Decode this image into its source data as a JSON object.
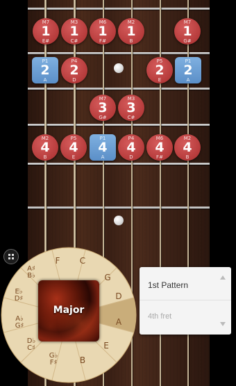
{
  "fretboard": {
    "notes": [
      {
        "interval": "M7",
        "finger": "1",
        "name": "E#",
        "shape": "red"
      },
      {
        "interval": "M3",
        "finger": "1",
        "name": "C#",
        "shape": "red"
      },
      {
        "interval": "M6",
        "finger": "1",
        "name": "F#",
        "shape": "red"
      },
      {
        "interval": "M2",
        "finger": "1",
        "name": "B",
        "shape": "red"
      },
      {
        "interval": "M7",
        "finger": "1",
        "name": "G#",
        "shape": "red"
      },
      {
        "interval": "P1",
        "finger": "2",
        "name": "A",
        "shape": "blue"
      },
      {
        "interval": "P4",
        "finger": "2",
        "name": "D",
        "shape": "red"
      },
      {
        "interval": "P5",
        "finger": "2",
        "name": "E",
        "shape": "red"
      },
      {
        "interval": "P1",
        "finger": "2",
        "name": "A",
        "shape": "blue"
      },
      {
        "interval": "M7",
        "finger": "3",
        "name": "G#",
        "shape": "red"
      },
      {
        "interval": "M3",
        "finger": "3",
        "name": "C#",
        "shape": "red"
      },
      {
        "interval": "M2",
        "finger": "4",
        "name": "B",
        "shape": "red"
      },
      {
        "interval": "P5",
        "finger": "4",
        "name": "E",
        "shape": "red"
      },
      {
        "interval": "P1",
        "finger": "4",
        "name": "A",
        "shape": "blue"
      },
      {
        "interval": "P4",
        "finger": "4",
        "name": "D",
        "shape": "red"
      },
      {
        "interval": "M6",
        "finger": "4",
        "name": "F#",
        "shape": "red"
      },
      {
        "interval": "M2",
        "finger": "4",
        "name": "B",
        "shape": "red"
      }
    ]
  },
  "key_wheel": {
    "keys": [
      "F",
      "C",
      "G",
      "D",
      "A",
      "E",
      "B",
      "G♭ F♯",
      "D♭ C♯",
      "A♭ G♯",
      "E♭ D♯",
      "A♯ B♭"
    ],
    "selected_key": "A",
    "scale": "Major"
  },
  "pattern_picker": {
    "pattern": "1st Pattern",
    "fret": "4th fret"
  },
  "icons": {
    "menu": "grid-menu-icon",
    "up": "chevron-up-icon",
    "down": "chevron-down-icon"
  }
}
